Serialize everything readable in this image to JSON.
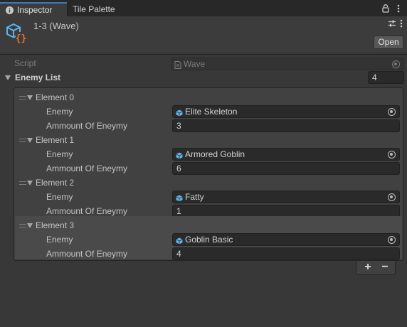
{
  "tabs": {
    "inspector": "Inspector",
    "tile_palette": "Tile Palette"
  },
  "header": {
    "title": "1-3 (Wave)",
    "open_label": "Open"
  },
  "script": {
    "label": "Script",
    "value": "Wave"
  },
  "enemy_list": {
    "label": "Enemy List",
    "size": "4",
    "elements": [
      {
        "name": "Element 0",
        "enemy_label": "Enemy",
        "enemy_value": "Elite Skeleton",
        "amount_label": "Ammount Of Eneymy",
        "amount_value": "3"
      },
      {
        "name": "Element 1",
        "enemy_label": "Enemy",
        "enemy_value": "Armored Goblin",
        "amount_label": "Ammount Of Eneymy",
        "amount_value": "6"
      },
      {
        "name": "Element 2",
        "enemy_label": "Enemy",
        "enemy_value": "Fatty",
        "amount_label": "Ammount Of Eneymy",
        "amount_value": "1"
      },
      {
        "name": "Element 3",
        "enemy_label": "Enemy",
        "enemy_value": "Goblin Basic",
        "amount_label": "Ammount Of Eneymy",
        "amount_value": "4"
      }
    ]
  },
  "footer": {
    "add_label": "+",
    "remove_label": "−"
  },
  "icons": {
    "inspector_tab": "info-icon",
    "lock": "lock-icon",
    "menu": "kebab-menu-icon",
    "object": "scriptable-object-icon",
    "settings": "sliders-icon",
    "prefab": "prefab-icon",
    "object_picker": "object-picker-icon"
  },
  "colors": {
    "accent_tab": "#3a79bb",
    "prefab_blue": "#5fb4ea",
    "script_orange": "#e8722c"
  }
}
